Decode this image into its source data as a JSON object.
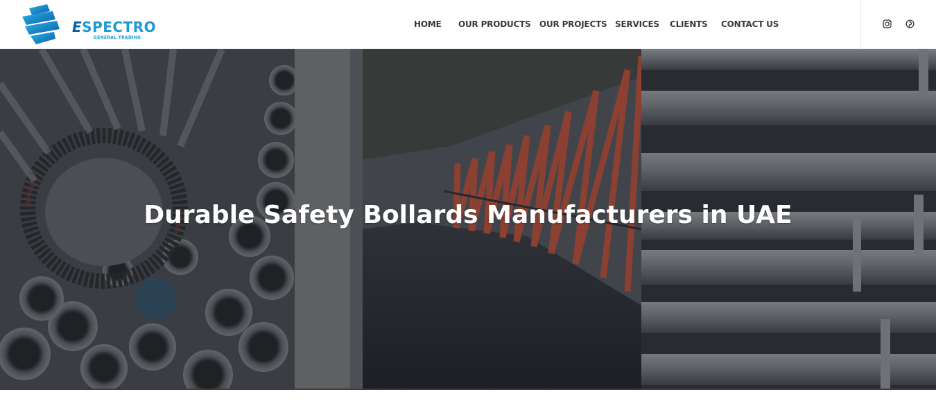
{
  "brand": {
    "name_prefix": "E",
    "name": "SPECTRO",
    "tagline": "GENERAL TRADING",
    "primary_color": "#1d9ad6",
    "dark_color": "#0b5fa8"
  },
  "nav": {
    "items": [
      {
        "label": "HOME"
      },
      {
        "label": "OUR PRODUCTS"
      },
      {
        "label": "OUR PROJECTS"
      },
      {
        "label": "SERVICES"
      },
      {
        "label": "CLIENTS"
      },
      {
        "label": "CONTACT US"
      }
    ]
  },
  "social": {
    "icons": [
      "instagram-icon",
      "pinterest-icon"
    ]
  },
  "hero": {
    "title": "Durable Safety Bollards Manufacturers in UAE",
    "overlay_color": "#1f2226",
    "accent_color": "#d9573a"
  }
}
